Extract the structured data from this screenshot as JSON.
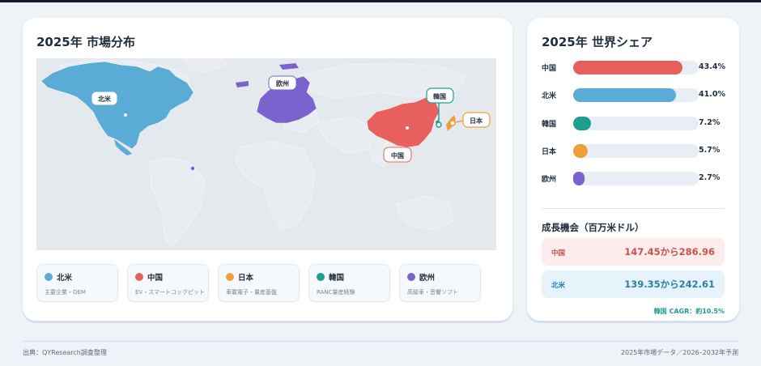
{
  "map_card": {
    "title": "2025年 市場分布",
    "regions": [
      {
        "name": "北米",
        "color": "#5aabd6"
      },
      {
        "name": "欧州",
        "color": "#7a63cc"
      },
      {
        "name": "中国",
        "color": "#e8605e"
      },
      {
        "name": "韓国",
        "color": "#1d9e8f"
      },
      {
        "name": "日本",
        "color": "#ef9f3a"
      }
    ],
    "legend": [
      {
        "name": "北米",
        "desc": "主要企業・OEM",
        "color": "#5aabd6"
      },
      {
        "name": "中国",
        "desc": "EV・スマートコックピット",
        "color": "#e8605e"
      },
      {
        "name": "日本",
        "desc": "車載電子・量産基盤",
        "color": "#ef9f3a"
      },
      {
        "name": "韓国",
        "desc": "RANC量産経験",
        "color": "#1d9e8f"
      },
      {
        "name": "欧州",
        "desc": "高級車・音響ソフト",
        "color": "#7a63cc"
      }
    ]
  },
  "share_card": {
    "title": "2025年 世界シェア",
    "bars": [
      {
        "label": "中国",
        "value": "43.4%",
        "pct": 43.4,
        "color": "#e8605e"
      },
      {
        "label": "北米",
        "value": "41.0%",
        "pct": 41.0,
        "color": "#5aabd6"
      },
      {
        "label": "韓国",
        "value": "7.2%",
        "pct": 7.2,
        "color": "#1d9e8f"
      },
      {
        "label": "日本",
        "value": "5.7%",
        "pct": 5.7,
        "color": "#ef9f3a"
      },
      {
        "label": "欧州",
        "value": "2.7%",
        "pct": 2.7,
        "color": "#7a63cc"
      }
    ],
    "growth_title": "成長機会（百万米ドル）",
    "opportunities": [
      {
        "label": "中国",
        "value": "147.45から286.96",
        "bg": "#fdecec",
        "color": "#c9504d"
      },
      {
        "label": "北米",
        "value": "139.35から242.61",
        "bg": "#e6f3fa",
        "color": "#2a7fab"
      }
    ],
    "cagr": "韓国 CAGR：約10.5%"
  },
  "footer": {
    "source": "出典：QYResearch調査整理",
    "note": "2025年市場データ／2026–2032年予測"
  }
}
